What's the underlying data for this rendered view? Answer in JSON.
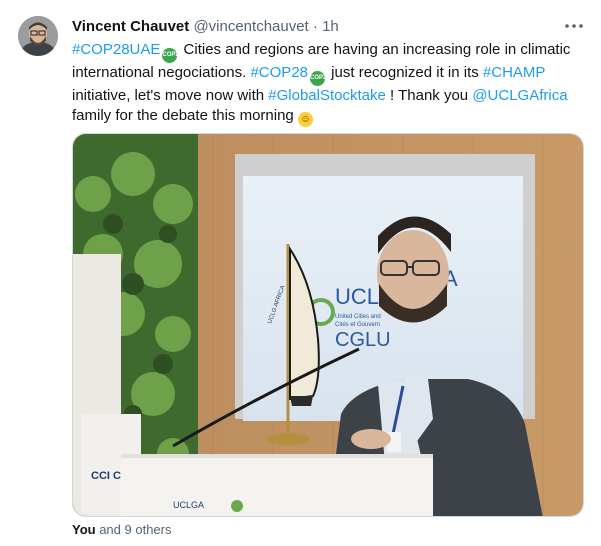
{
  "author": {
    "name": "Vincent Chauvet",
    "handle": "@vincentchauvet",
    "separator": "·",
    "time": "1h"
  },
  "more_icon": "more-horizontal-icon",
  "tweet": {
    "line1": {
      "hashtag_cop28uae": "#COP28UAE",
      "text_a": " Cities and regions are having an increasing role in climatic"
    },
    "line2": {
      "text_a": "international negociations. ",
      "hashtag_cop28": "#COP28",
      "text_b": " just recognized it in its ",
      "hashtag_champ": "#CHAMP"
    },
    "line3": {
      "text_a": "initiative, let's move now with ",
      "hashtag_gst": "#GlobalStocktake",
      "text_b": " ! Thank you ",
      "mention": "@UCLGAfrica"
    },
    "line4": {
      "text_a": "family for the debate this morning "
    },
    "cop_badge": "COP28",
    "emoji": "smiling-face-icon"
  },
  "photo": {
    "screen_text_a": "UCLG",
    "screen_text_b": "A",
    "screen_small_1": "United Cities and",
    "screen_small_2": "Cités et Gouvern",
    "screen_text_c": "CGLU",
    "flag_text": "UCLG AFRICA",
    "pillar_text": "CCI CEN",
    "podium_text": "UCLGA"
  },
  "likes": {
    "you": "You",
    "rest": " and 9 others"
  },
  "colors": {
    "link": "#1d9bf0",
    "muted": "#536471",
    "text": "#0f1419"
  }
}
